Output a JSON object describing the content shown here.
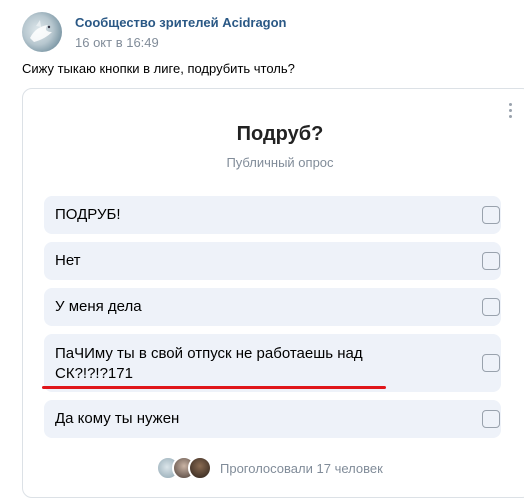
{
  "post": {
    "author": "Сообщество зрителей Acidragon",
    "date": "16 окт в 16:49",
    "text": "Сижу тыкаю кнопки в лиге, подрубить чтоль?"
  },
  "poll": {
    "title": "Подруб?",
    "subtitle": "Публичный опрос",
    "options": [
      {
        "label": "ПОДРУБ!",
        "checked": false
      },
      {
        "label": "Нет",
        "checked": false
      },
      {
        "label": "У меня дела",
        "checked": false
      },
      {
        "label": "ПаЧИму ты в свой отпуск не работаешь над СК?!?!?171",
        "checked": false
      },
      {
        "label": "Да кому ты нужен",
        "checked": false
      }
    ],
    "voters_text": "Проголосовали 17 человек"
  },
  "icons": {
    "avatar": "community-avatar-icon",
    "more": "more-vertical-icon",
    "checkbox": "checkbox-icon"
  },
  "colors": {
    "link": "#2a5885",
    "muted": "#818c99",
    "option_bg": "#eef2f9",
    "highlight_line": "#e0161b"
  }
}
